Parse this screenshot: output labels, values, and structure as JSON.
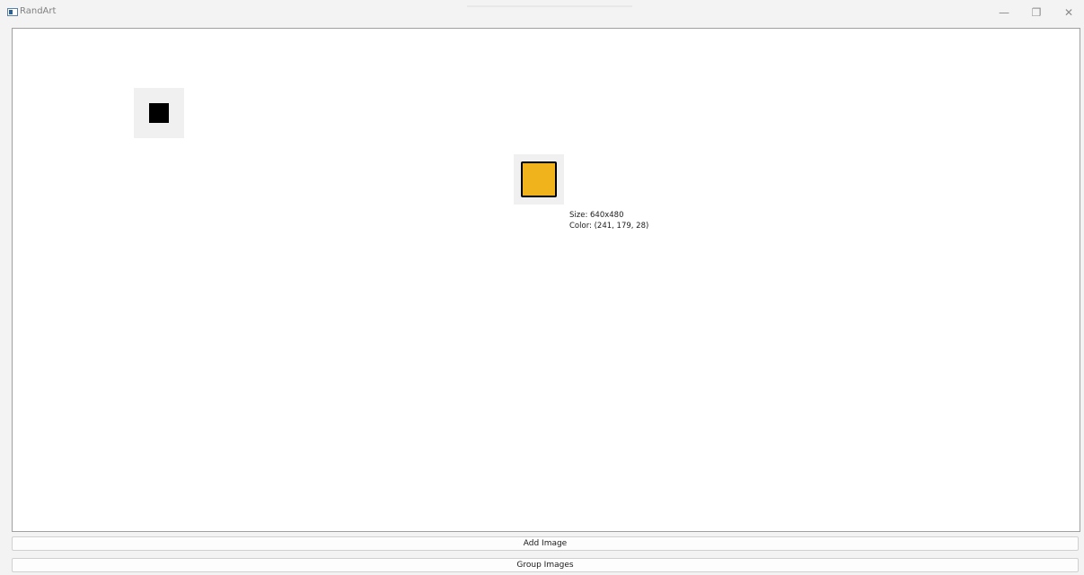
{
  "window": {
    "title": "RandArt",
    "minimize_glyph": "—",
    "maximize_glyph": "❐",
    "close_glyph": "✕"
  },
  "canvas": {
    "images": [
      {
        "color_name": "black",
        "color": "#000000"
      },
      {
        "color_name": "orange",
        "color": "#f1b31c"
      }
    ],
    "info": {
      "size": "Size: 640x480",
      "color": "Color: (241, 179, 28)"
    }
  },
  "buttons": {
    "add_image": "Add Image",
    "group_images": "Group Images"
  }
}
